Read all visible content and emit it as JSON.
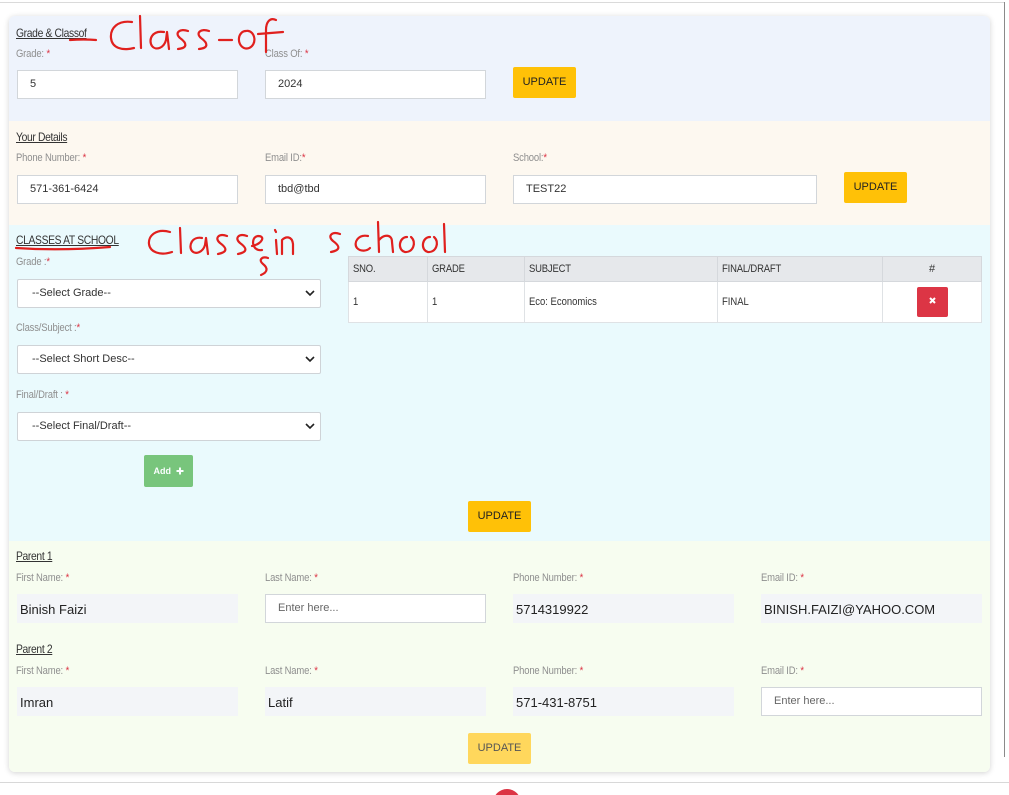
{
  "grade_classof": {
    "title": "Grade & Classof",
    "grade_label": "Grade:",
    "grade_value": "5",
    "classof_label": "Class Of:",
    "classof_value": "2024",
    "update_label": "UPDATE"
  },
  "your_details": {
    "title": "Your Details",
    "phone_label": "Phone Number:",
    "phone_value": "571-361-6424",
    "email_label": "Email ID:",
    "email_value": "tbd@tbd",
    "school_label": "School:",
    "school_value": "TEST22",
    "update_label": "UPDATE"
  },
  "classes": {
    "title": "CLASSES AT SCHOOL",
    "grade_label": "Grade :",
    "grade_select": "--Select Grade--",
    "subject_label": "Class/Subject :",
    "subject_select": "--Select Short Desc--",
    "final_label": "Final/Draft :",
    "final_select": "--Select Final/Draft--",
    "add_label": "Add",
    "update_label": "UPDATE",
    "table": {
      "headers": [
        "SNO.",
        "GRADE",
        "SUBJECT",
        "FINAL/DRAFT",
        "#"
      ],
      "rows": [
        {
          "sno": "1",
          "grade": "1",
          "subject": "Eco: Economics",
          "status": "FINAL"
        }
      ]
    }
  },
  "parent1": {
    "title": "Parent 1",
    "first_label": "First Name:",
    "first_value": "Binish Faizi",
    "last_label": "Last Name:",
    "last_placeholder": "Enter here...",
    "phone_label": "Phone Number:",
    "phone_value": "5714319922",
    "email_label": "Email ID:",
    "email_value": "BINISH.FAIZI@YAHOO.COM"
  },
  "parent2": {
    "title": "Parent 2",
    "first_label": "First Name:",
    "first_value": "Imran",
    "last_label": "Last Name:",
    "last_value": "Latif",
    "phone_label": "Phone Number:",
    "phone_value": "571-431-8751",
    "email_label": "Email ID:",
    "email_placeholder": "Enter here...",
    "update_label": "UPDATE"
  },
  "required_mark": "*",
  "colors": {
    "update_button": "#ffc107",
    "delete_button": "#dc3545",
    "add_button": "#5cb85c",
    "required": "#dc3545",
    "annotation_ink": "#e0201e"
  },
  "icons": {
    "select_chevron": "chevron-down-icon",
    "add_plus": "plus-icon",
    "delete_x": "close-icon"
  }
}
